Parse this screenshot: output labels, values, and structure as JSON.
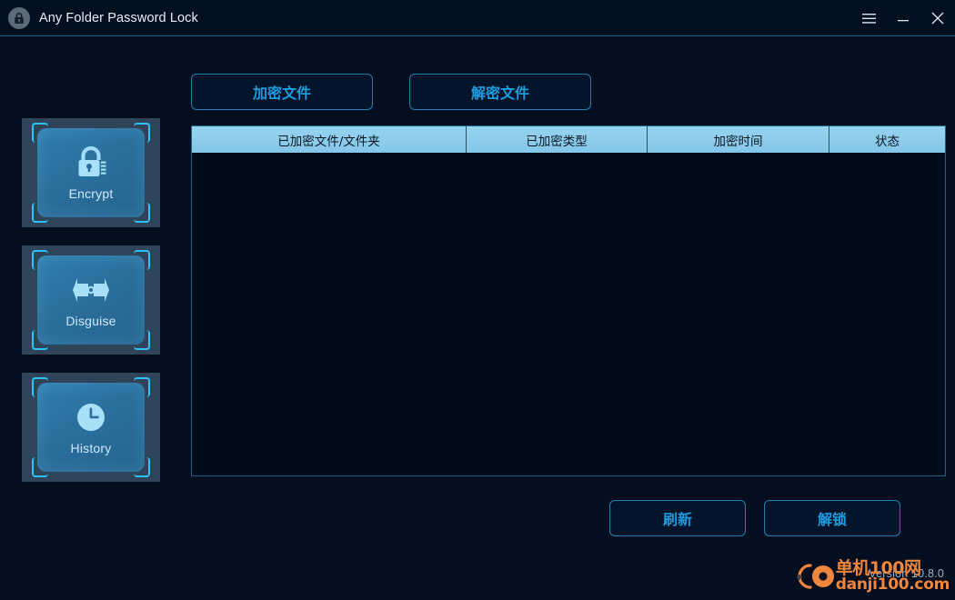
{
  "window": {
    "title": "Any Folder Password Lock",
    "logo_icon": "lock-circle-icon",
    "controls": {
      "menu_label": "☰",
      "menu_icon": "hamburger-menu-icon",
      "minimize_label": "—",
      "minimize_icon": "minimize-icon",
      "close_label": "✕",
      "close_icon": "close-icon"
    }
  },
  "sidebar": {
    "items": [
      {
        "label": "Encrypt",
        "icon": "padlock-icon"
      },
      {
        "label": "Disguise",
        "icon": "mask-swap-icon"
      },
      {
        "label": "History",
        "icon": "clock-icon"
      }
    ]
  },
  "tabs": [
    {
      "label": "加密文件"
    },
    {
      "label": "解密文件"
    }
  ],
  "table": {
    "columns": [
      "已加密文件/文件夹",
      "已加密类型",
      "加密时间",
      "状态"
    ],
    "rows": []
  },
  "actions": [
    {
      "label": "刷新"
    },
    {
      "label": "解锁"
    }
  ],
  "footer": {
    "version": "Version 10.8.0"
  },
  "watermark": {
    "line1": "单机100网",
    "line2": "danji100.com",
    "color": "#f0863c",
    "logo_icon": "danji100-logo-icon"
  },
  "colors": {
    "window_bg": "#030f1e",
    "titlebar_bg": "#02101f",
    "accent": "#1a9de0",
    "header_bg": "#8ecdec",
    "button_gradient_from": "#2f7fae",
    "button_gradient_to": "#27648f",
    "bracket": "#2fc2f5"
  }
}
